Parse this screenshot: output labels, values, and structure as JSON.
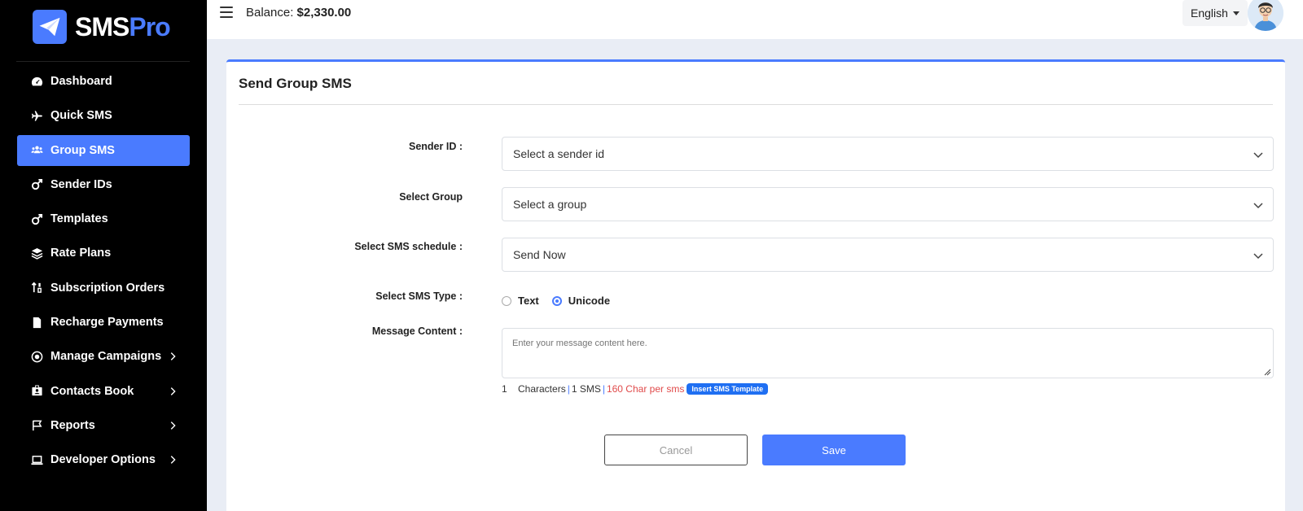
{
  "brand": {
    "name_main": "SMS",
    "name_accent": "Pro"
  },
  "sidebar": {
    "items": [
      {
        "label": "Dashboard",
        "icon": "dashboard-icon"
      },
      {
        "label": "Quick SMS",
        "icon": "plane-icon"
      },
      {
        "label": "Group SMS",
        "icon": "users-icon",
        "active": true
      },
      {
        "label": "Sender IDs",
        "icon": "mars-icon"
      },
      {
        "label": "Templates",
        "icon": "mars-icon"
      },
      {
        "label": "Rate Plans",
        "icon": "layers-icon"
      },
      {
        "label": "Subscription Orders",
        "icon": "sort-icon"
      },
      {
        "label": "Recharge Payments",
        "icon": "invoice-icon"
      },
      {
        "label": "Manage Campaigns",
        "icon": "campaign-icon",
        "has_children": true
      },
      {
        "label": "Contacts Book",
        "icon": "contact-book-icon",
        "has_children": true
      },
      {
        "label": "Reports",
        "icon": "flag-icon",
        "has_children": true
      },
      {
        "label": "Developer Options",
        "icon": "laptop-icon",
        "has_children": true
      }
    ]
  },
  "topbar": {
    "balance_label": "Balance:",
    "balance_value": "$2,330.00",
    "language": "English"
  },
  "form": {
    "title": "Send Group SMS",
    "sender_id": {
      "label": "Sender ID :",
      "value": "Select a sender id"
    },
    "group": {
      "label": "Select Group",
      "value": "Select a group"
    },
    "schedule": {
      "label": "Select SMS schedule :",
      "value": "Send Now"
    },
    "sms_type": {
      "label": "Select SMS Type :",
      "options": [
        "Text",
        "Unicode"
      ],
      "selected": "Unicode"
    },
    "message": {
      "label": "Message Content :",
      "placeholder": "Enter your message content here."
    },
    "counter": {
      "count": "1",
      "characters": "Characters",
      "sep": "|",
      "sms": "1 SMS",
      "per_sms": "160 Char per sms",
      "template_button": "Insert SMS Template"
    },
    "cancel_label": "Cancel",
    "save_label": "Save"
  },
  "colors": {
    "accent": "#4a7bff",
    "sidebar_bg": "#000000",
    "page_bg": "#e9edf5",
    "warning_text": "#e04a4a"
  }
}
